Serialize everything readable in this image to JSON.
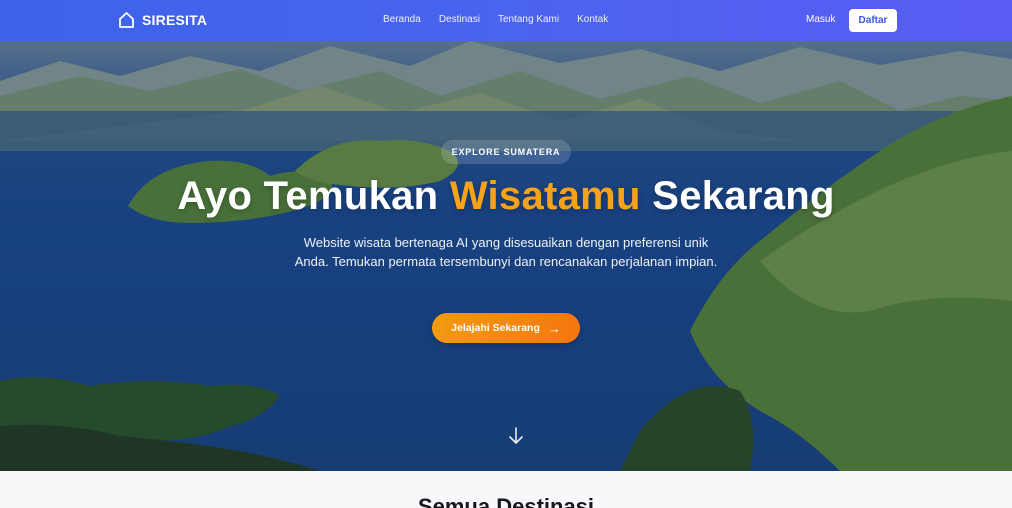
{
  "brand": {
    "name": "SIRESITA",
    "icon": "home-icon"
  },
  "nav": {
    "links": [
      "Beranda",
      "Destinasi",
      "Tentang Kami",
      "Kontak"
    ],
    "login_label": "Masuk",
    "register_label": "Daftar"
  },
  "hero": {
    "badge": "EXPLORE SUMATERA",
    "title_part1": "Ayo Temukan ",
    "title_accent": "Wisatamu",
    "title_part2": " Sekarang",
    "subtitle": "Website wisata bertenaga AI yang disesuaikan dengan preferensi unik Anda. Temukan permata tersembunyi dan rencanakan perjalanan impian.",
    "cta_label": "Jelajahi Sekarang",
    "cta_icon": "arrow-right-icon",
    "scroll_icon": "arrow-down-icon"
  },
  "section": {
    "title": "Semua Destinasi"
  },
  "colors": {
    "nav_start": "#3d63ea",
    "nav_end": "#5a5cf3",
    "accent": "#f7a21b",
    "cta_start": "#f29a12",
    "cta_end": "#f5760e"
  }
}
